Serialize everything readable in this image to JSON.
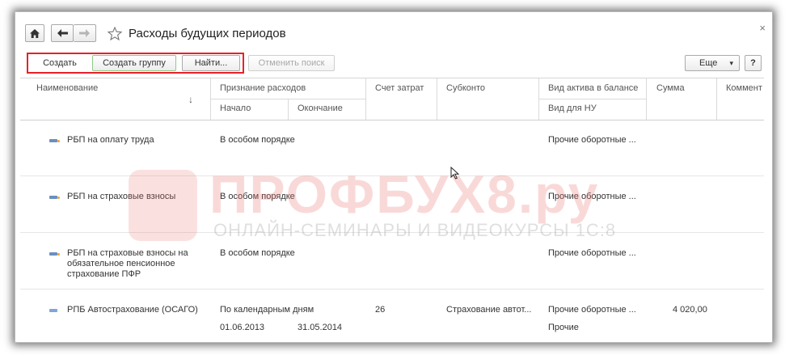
{
  "window": {
    "title": "Расходы будущих периодов",
    "close_glyph": "×"
  },
  "nav": {
    "home_icon": "home-icon",
    "back_icon": "arrow-left-icon",
    "forward_icon": "arrow-right-icon",
    "favorite_icon": "star-icon"
  },
  "toolbar": {
    "create_label": "Создать",
    "create_group_label": "Создать группу",
    "find_label": "Найти...",
    "cancel_search_label": "Отменить поиск",
    "more_label": "Еще",
    "more_caret": "▾",
    "help_label": "?"
  },
  "columns": {
    "name": "Наименование",
    "sort_glyph": "↓",
    "recognition": "Признание расходов",
    "start": "Начало",
    "end": "Окончание",
    "cost_account": "Счет затрат",
    "subconto": "Субконто",
    "asset_type": "Вид актива в балансе",
    "tax_type": "Вид для НУ",
    "amount": "Сумма",
    "comment": "Коммент"
  },
  "rows": [
    {
      "name": "РБП на оплату труда",
      "recognition": "В особом порядке",
      "start": "",
      "end": "",
      "cost_account": "",
      "subconto": "",
      "asset_type": "Прочие оборотные ...",
      "tax_type": "",
      "amount": ""
    },
    {
      "name": "РБП на страховые взносы",
      "recognition": "В особом порядке",
      "start": "",
      "end": "",
      "cost_account": "",
      "subconto": "",
      "asset_type": "Прочие оборотные ...",
      "tax_type": "",
      "amount": ""
    },
    {
      "name": "РБП на страховые взносы на обязательное пенсионное страхование ПФР",
      "recognition": "В особом порядке",
      "start": "",
      "end": "",
      "cost_account": "",
      "subconto": "",
      "asset_type": "Прочие оборотные ...",
      "tax_type": "",
      "amount": ""
    },
    {
      "name": "РПБ Автострахование (ОСАГО)",
      "recognition": "По календарным дням",
      "start": "01.06.2013",
      "end": "31.05.2014",
      "cost_account": "26",
      "subconto": "Страхование автот...",
      "asset_type": "Прочие оборотные ...",
      "tax_type": "Прочие",
      "amount": "4 020,00"
    }
  ],
  "watermark": {
    "main": "ПРОФБУХ8.ру",
    "sub": "ОНЛАЙН-СЕМИНАРЫ И ВИДЕОКУРСЫ 1С:8"
  },
  "colors": {
    "highlight": "#e8202a",
    "create_group_border": "#8fc98a"
  }
}
